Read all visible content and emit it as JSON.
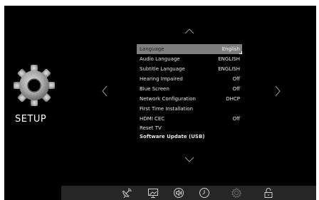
{
  "header": {
    "title": "SETUP"
  },
  "icons": {
    "gear": "gear-icon",
    "up": "chevron-up-icon",
    "down": "chevron-down-icon",
    "left": "chevron-left-icon",
    "right": "chevron-right-icon"
  },
  "menu": {
    "items": [
      {
        "label": "Language",
        "value": "English",
        "selected": true
      },
      {
        "label": "Audio Language",
        "value": "ENGLISH"
      },
      {
        "label": "Subtitle Language",
        "value": "ENGLISH"
      },
      {
        "label": "Hearing Impaired",
        "value": "Off"
      },
      {
        "label": "Blue Screen",
        "value": "Off"
      },
      {
        "label": "Network Configuration",
        "value": "DHCP"
      },
      {
        "label": "First Time Installation",
        "value": ""
      },
      {
        "label": "HDMI CEC",
        "value": "Off"
      },
      {
        "label": "Reset TV",
        "value": ""
      },
      {
        "label": "Software Update (USB)",
        "value": ""
      }
    ]
  },
  "bottom_bar": {
    "icons": [
      "satellite-dish-icon",
      "picture-icon",
      "sound-icon",
      "clock-icon",
      "settings-icon",
      "lock-icon"
    ],
    "active": "settings-icon"
  },
  "colors": {
    "background": "#000000",
    "highlight": "#7e7e7e",
    "text": "#e8e8e8",
    "bar": "#262626"
  }
}
